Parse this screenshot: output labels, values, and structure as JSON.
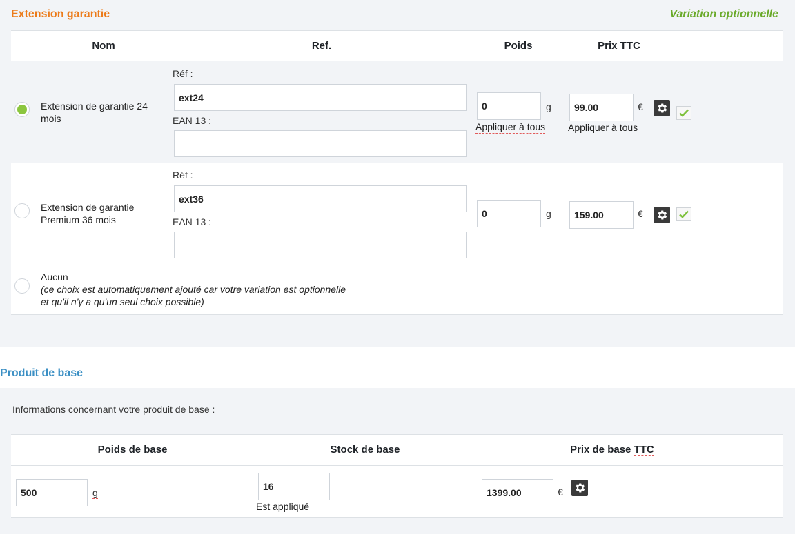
{
  "section1": {
    "title": "Extension garantie",
    "variation_label": "Variation optionnelle",
    "headers": {
      "nom": "Nom",
      "ref": "Ref.",
      "poids": "Poids",
      "prix": "Prix TTC"
    },
    "ref_label": "Réf :",
    "ean_label": "EAN 13 :",
    "weight_unit": "g",
    "currency": "€",
    "apply_all": "Appliquer à tous",
    "rows": [
      {
        "name_line1": "Extension de garantie 24",
        "name_line2": "mois",
        "ref": "ext24",
        "ean": "",
        "weight": "0",
        "price": "99.00",
        "selected": true
      },
      {
        "name_line1": "Extension de garantie",
        "name_line2": "Premium 36 mois",
        "ref": "ext36",
        "ean": "",
        "weight": "0",
        "price": "159.00",
        "selected": false
      }
    ],
    "none_option": {
      "label": "Aucun",
      "note_line1": "(ce choix est automatiquement ajouté car votre variation est optionnelle",
      "note_line2": "et qu'il n'y a qu'un seul choix possible)"
    }
  },
  "section2": {
    "title": "Produit de base",
    "info": "Informations concernant votre produit de base :",
    "headers": {
      "poids": "Poids de base",
      "stock": "Stock de base",
      "prix": "Prix de base",
      "ttc": "TTC"
    },
    "weight": "500",
    "weight_unit": "g",
    "stock": "16",
    "stock_status": "Est appliqué",
    "price": "1399.00",
    "currency": "€"
  },
  "colors": {
    "orange": "#ec7b1a",
    "green": "#6aaa2a",
    "blue": "#3b8fc4",
    "radio_selected": "#8cc63f"
  }
}
